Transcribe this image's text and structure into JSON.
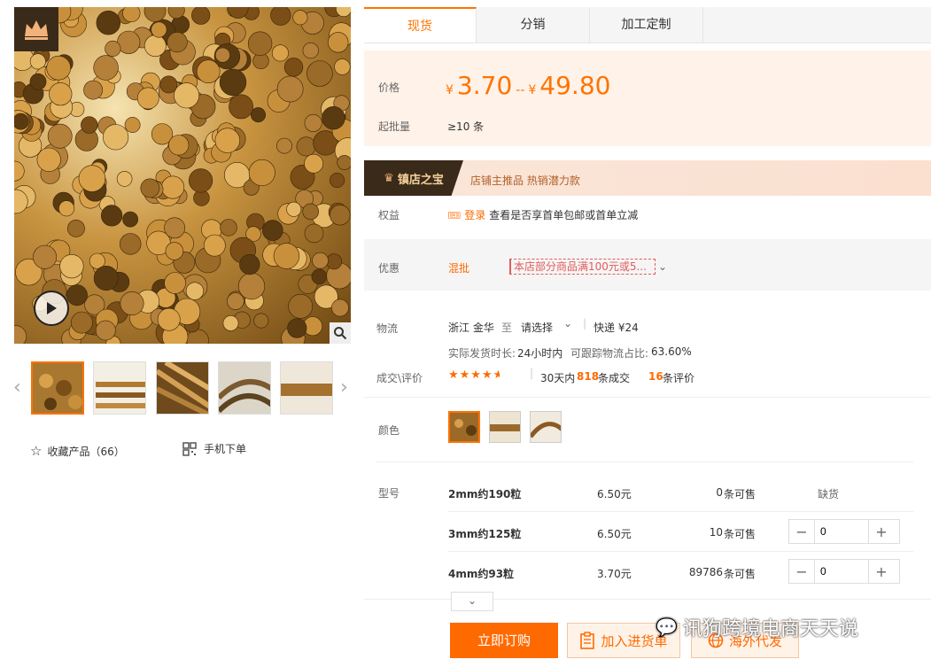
{
  "tabs": [
    "现货",
    "分销",
    "加工定制"
  ],
  "price": {
    "label": "价格",
    "currency": "¥",
    "min": "3.70",
    "separator": "--",
    "max": "49.80",
    "moq_label": "起批量",
    "moq_value": "≥10 条"
  },
  "badge": {
    "title": "镇店之宝",
    "tags": "店铺主推品  热销潜力款"
  },
  "benefits": {
    "label": "权益",
    "login": "登录",
    "text": "查看是否享首单包邮或首单立减"
  },
  "promo": {
    "label": "优惠",
    "type": "混批",
    "text": "本店部分商品满100元或5..."
  },
  "logistics": {
    "label": "物流",
    "origin": "浙江 金华",
    "to": "至",
    "destination": "请选择",
    "express": "快递 ¥24",
    "ship_time_label": "实际发货时长:",
    "ship_time": "24小时内",
    "track_label": "可跟踪物流占比:",
    "track_ratio": "63.60%"
  },
  "deals": {
    "label": "成交\\评价",
    "rating": 4.5,
    "period": "30天内",
    "count": "818",
    "count_suffix": "条成交",
    "reviews": "16",
    "reviews_suffix": "条评价"
  },
  "color": {
    "label": "颜色"
  },
  "variants": {
    "label": "型号",
    "items": [
      {
        "name": "2mm约190粒",
        "price": "6.50元",
        "stock": "0",
        "stock_suffix": "条可售",
        "status": "缺货",
        "qty": ""
      },
      {
        "name": "3mm约125粒",
        "price": "6.50元",
        "stock": "10",
        "stock_suffix": "条可售",
        "status": "",
        "qty": "0"
      },
      {
        "name": "4mm约93粒",
        "price": "3.70元",
        "stock": "89786",
        "stock_suffix": "条可售",
        "status": "",
        "qty": "0"
      }
    ]
  },
  "actions": {
    "order": "立即订购",
    "cart": "加入进货单",
    "oversea": "海外代发"
  },
  "left": {
    "favorite": "收藏产品（66）",
    "mobile": "手机下单"
  },
  "watermark": "讯狗跨境电商天天说",
  "colors": {
    "accent": "#ff7300",
    "price_bg": "#fff2e8"
  }
}
